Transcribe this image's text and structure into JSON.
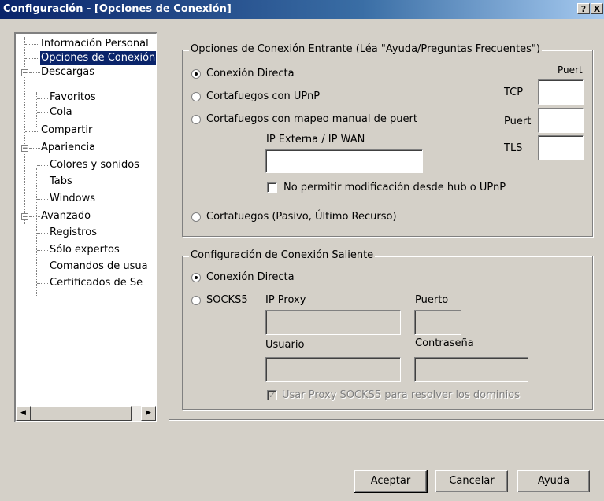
{
  "window": {
    "title": "Configuración - [Opciones de Conexión]",
    "help_btn": "?",
    "close_btn": "X"
  },
  "tree": {
    "items": [
      {
        "label": "Información Personal"
      },
      {
        "label": "Opciones de Conexión"
      },
      {
        "label": "Descargas",
        "expander": "−"
      },
      {
        "label": "Favoritos"
      },
      {
        "label": "Cola"
      },
      {
        "label": "Compartir"
      },
      {
        "label": "Apariencia",
        "expander": "−"
      },
      {
        "label": "Colores y sonidos"
      },
      {
        "label": "Tabs"
      },
      {
        "label": "Windows"
      },
      {
        "label": "Avanzado",
        "expander": "−"
      },
      {
        "label": "Registros"
      },
      {
        "label": "Sólo expertos"
      },
      {
        "label": "Comandos de usua"
      },
      {
        "label": "Certificados de Se"
      }
    ],
    "selected_index": 1
  },
  "scrollbar": {
    "left_arrow": "◀",
    "right_arrow": "▶"
  },
  "incoming": {
    "title": "Opciones de Conexión Entrante (Léa \"Ayuda/Preguntas Frecuentes\")",
    "radio_direct": "Conexión Directa",
    "radio_upnp": "Cortafuegos con UPnP",
    "radio_manual": "Cortafuegos con mapeo manual de puert",
    "radio_passive": "Cortafuegos (Pasivo, Último Recurso)",
    "ext_ip_label": "IP Externa / IP WAN",
    "ext_ip_value": "",
    "no_modify_label": "No permitir modificación desde hub o UPnP",
    "ports_header": "Puert",
    "tcp_label": "TCP",
    "udp_label": "Puert",
    "tls_label": "TLS",
    "tcp_value": "",
    "udp_value": "",
    "tls_value": "",
    "selected": "direct"
  },
  "outgoing": {
    "title": "Configuración de Conexión Saliente",
    "radio_direct": "Conexión Directa",
    "radio_socks": "SOCKS5",
    "proxy_ip_label": "IP Proxy",
    "port_label": "Puerto",
    "user_label": "Usuario",
    "password_label": "Contraseña",
    "resolve_label": "Usar Proxy SOCKS5 para resolver los dominios",
    "selected": "direct"
  },
  "buttons": {
    "accept": "Aceptar",
    "cancel": "Cancelar",
    "help": "Ayuda"
  }
}
